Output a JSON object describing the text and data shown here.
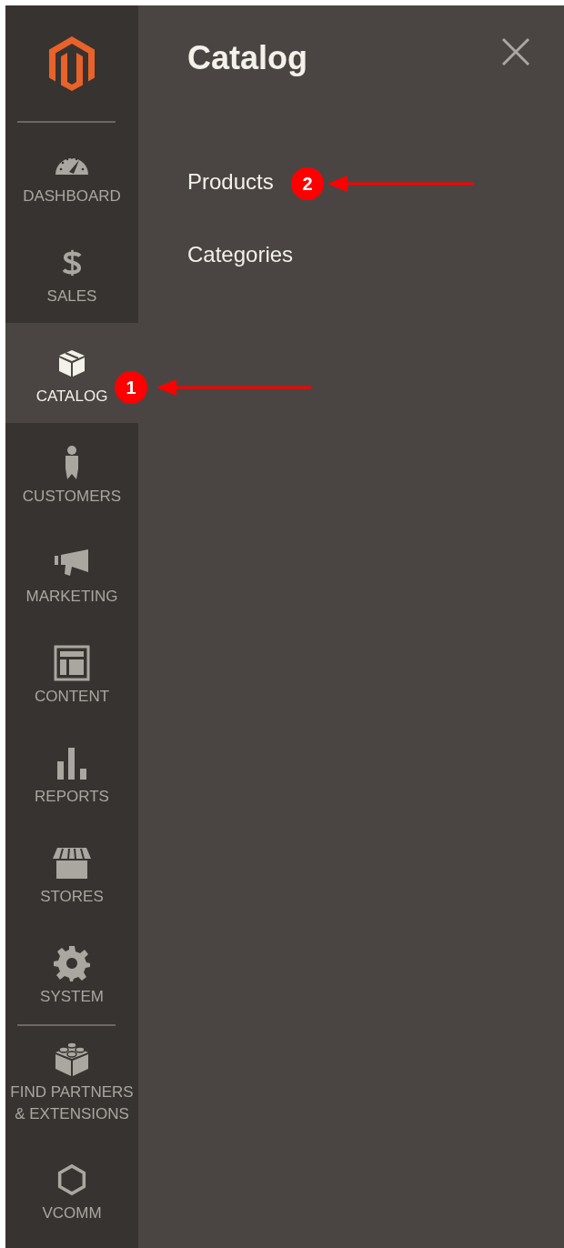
{
  "sidebar": {
    "items": [
      {
        "label": "DASHBOARD",
        "selected": false
      },
      {
        "label": "SALES",
        "selected": false
      },
      {
        "label": "CATALOG",
        "selected": true
      },
      {
        "label": "CUSTOMERS",
        "selected": false
      },
      {
        "label": "MARKETING",
        "selected": false
      },
      {
        "label": "CONTENT",
        "selected": false
      },
      {
        "label": "REPORTS",
        "selected": false
      },
      {
        "label": "STORES",
        "selected": false
      },
      {
        "label": "SYSTEM",
        "selected": false
      }
    ],
    "extensions": [
      {
        "label": "FIND PARTNERS & EXTENSIONS",
        "selected": false
      },
      {
        "label": "VCOMM",
        "selected": false
      }
    ]
  },
  "panel": {
    "title": "Catalog",
    "links": [
      {
        "label": "Products"
      },
      {
        "label": "Categories"
      }
    ]
  },
  "annotations": [
    {
      "number": "1"
    },
    {
      "number": "2"
    }
  ]
}
